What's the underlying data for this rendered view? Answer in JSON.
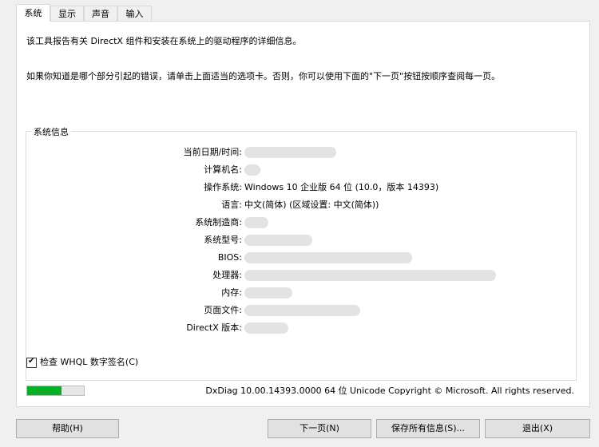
{
  "tabs": [
    "系统",
    "显示",
    "声音",
    "输入"
  ],
  "intro": {
    "line1": "该工具报告有关 DirectX 组件和安装在系统上的驱动程序的详细信息。",
    "line2": "如果你知道是哪个部分引起的错误，请单击上面适当的选项卡。否则，你可以使用下面的\"下一页\"按钮按顺序查阅每一页。"
  },
  "group_title": "系统信息",
  "rows": [
    {
      "label": "当前日期/时间:",
      "value": ""
    },
    {
      "label": "计算机名:",
      "value": ""
    },
    {
      "label": "操作系统:",
      "value": "Windows 10 企业版 64 位 (10.0，版本 14393)"
    },
    {
      "label": "语言:",
      "value": "中文(简体) (区域设置: 中文(简体))"
    },
    {
      "label": "系统制造商:",
      "value": ""
    },
    {
      "label": "系统型号:",
      "value": ""
    },
    {
      "label": "BIOS:",
      "value": ""
    },
    {
      "label": "处理器:",
      "value": ""
    },
    {
      "label": "内存:",
      "value": ""
    },
    {
      "label": "页面文件:",
      "value": ""
    },
    {
      "label": "DirectX 版本:",
      "value": ""
    }
  ],
  "checkbox": {
    "label": "检查 WHQL 数字签名(C)",
    "checked": true
  },
  "progress": {
    "fraction": 0.6,
    "color": "#06b025"
  },
  "copyright": "DxDiag 10.00.14393.0000 64 位 Unicode  Copyright © Microsoft. All rights reserved.",
  "buttons": {
    "help": "帮助(H)",
    "next": "下一页(N)",
    "save": "保存所有信息(S)...",
    "exit": "退出(X)"
  }
}
